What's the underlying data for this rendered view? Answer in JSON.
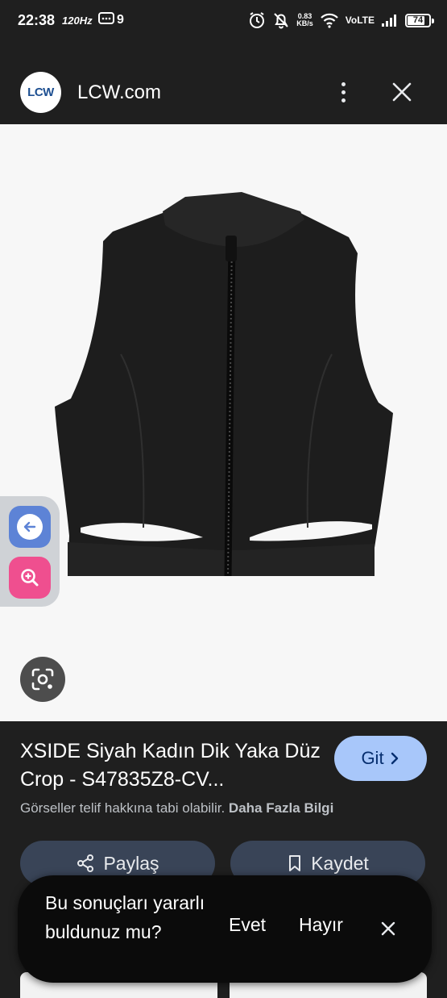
{
  "status_bar": {
    "time": "22:38",
    "refresh_rate": "120Hz",
    "message_count": "9",
    "speed_value": "0.83",
    "speed_unit": "KB/s",
    "network": "VoLTE",
    "battery": "74"
  },
  "header": {
    "logo_text": "LCW",
    "site_name": "LCW.com"
  },
  "product": {
    "title": "XSIDE Siyah Kadın Dik Yaka Düz Crop - S47835Z8-CV...",
    "visit_label": "Git",
    "copyright_text": "Görseller telif hakkına tabi olabilir.",
    "more_info": "Daha Fazla Bilgi",
    "share_label": "Paylaş",
    "save_label": "Kaydet"
  },
  "feedback": {
    "question": "Bu sonuçları yararlı buldunuz mu?",
    "yes": "Evet",
    "no": "Hayır"
  },
  "colors": {
    "background": "#1f1f1f",
    "accent": "#a8c7fa",
    "action_button": "#394457",
    "back_tool": "#5d83d6",
    "zoom_tool": "#ef4f8f"
  }
}
